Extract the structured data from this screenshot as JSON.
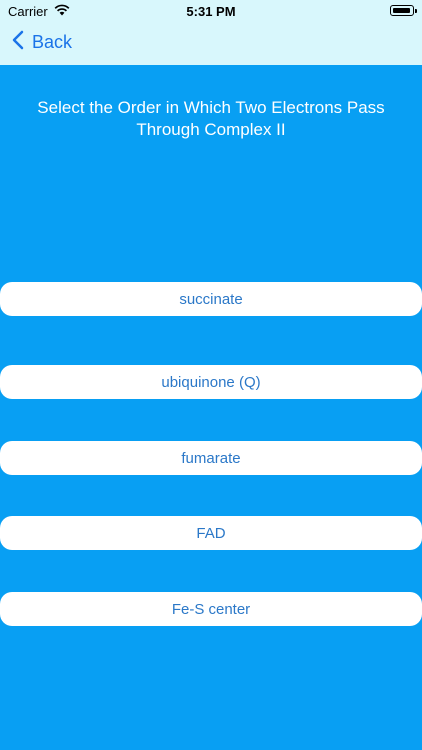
{
  "status_bar": {
    "carrier": "Carrier",
    "time": "5:31 PM"
  },
  "nav": {
    "back_label": "Back"
  },
  "question": {
    "text": "Select the Order in Which Two  Electrons Pass Through Complex II"
  },
  "options": [
    {
      "label": "succinate"
    },
    {
      "label": "ubiquinone (Q)"
    },
    {
      "label": "fumarate"
    },
    {
      "label": "FAD"
    },
    {
      "label": "Fe-S center"
    }
  ],
  "colors": {
    "background": "#089ff3",
    "topbar": "#d8f7fc",
    "accent": "#1a73e8",
    "option_text": "#2b78c8"
  }
}
